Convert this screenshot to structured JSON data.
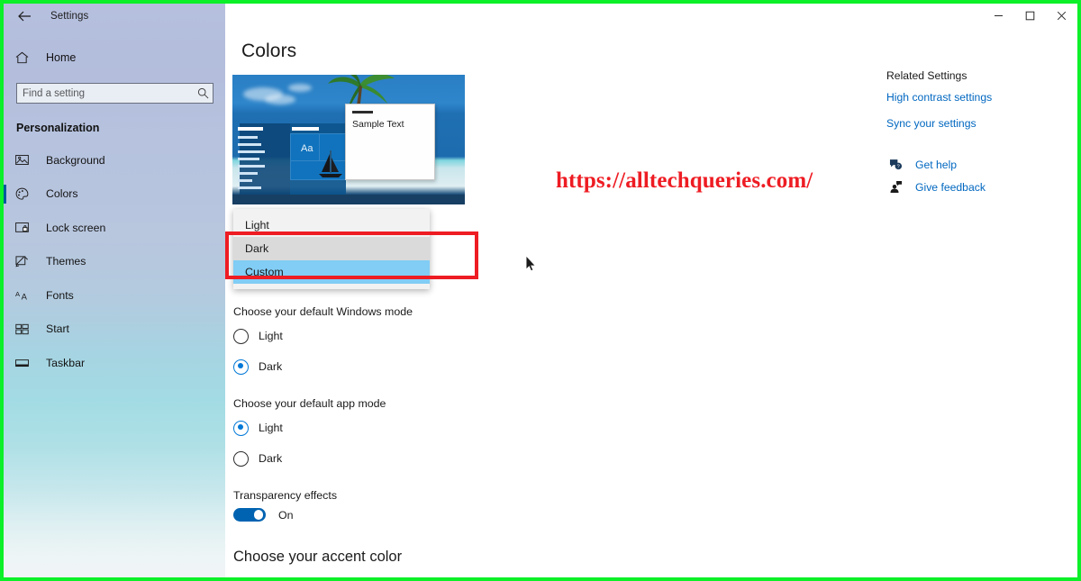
{
  "window": {
    "title": "Settings",
    "back_icon": "back-arrow-icon",
    "minimize_label": "–",
    "maximize_label": "❐",
    "close_label": "✕"
  },
  "sidebar": {
    "home_label": "Home",
    "home_icon": "home-icon",
    "search": {
      "placeholder": "Find a setting",
      "value": "",
      "icon": "search-icon"
    },
    "section_title": "Personalization",
    "items": [
      {
        "label": "Background",
        "icon": "picture-icon",
        "selected": false
      },
      {
        "label": "Colors",
        "icon": "palette-icon",
        "selected": true
      },
      {
        "label": "Lock screen",
        "icon": "lock-screen-icon",
        "selected": false
      },
      {
        "label": "Themes",
        "icon": "brush-icon",
        "selected": false
      },
      {
        "label": "Fonts",
        "icon": "fonts-icon",
        "selected": false
      },
      {
        "label": "Start",
        "icon": "start-tiles-icon",
        "selected": false
      },
      {
        "label": "Taskbar",
        "icon": "taskbar-icon",
        "selected": false
      }
    ]
  },
  "main": {
    "page_title": "Colors",
    "preview": {
      "sample_text": "Sample Text",
      "tile_text": "Aa"
    },
    "color_mode_dropdown": {
      "options": [
        "Light",
        "Dark",
        "Custom"
      ],
      "hovered": "Dark",
      "selected": "Custom"
    },
    "windows_mode": {
      "label": "Choose your default Windows mode",
      "options": [
        {
          "label": "Light",
          "checked": false
        },
        {
          "label": "Dark",
          "checked": true
        }
      ]
    },
    "app_mode": {
      "label": "Choose your default app mode",
      "options": [
        {
          "label": "Light",
          "checked": true
        },
        {
          "label": "Dark",
          "checked": false
        }
      ]
    },
    "transparency": {
      "label": "Transparency effects",
      "state_label": "On",
      "on": true
    },
    "accent_heading": "Choose your accent color"
  },
  "rail": {
    "title": "Related Settings",
    "links": [
      "High contrast settings",
      "Sync your settings"
    ],
    "actions": [
      {
        "label": "Get help",
        "icon": "help-chat-icon"
      },
      {
        "label": "Give feedback",
        "icon": "feedback-person-icon"
      }
    ]
  },
  "watermark": {
    "text": "https://alltechqueries.com/"
  },
  "colors": {
    "accent": "#0078d7",
    "highlight_red": "#ee1c23",
    "capture_border_green": "#0bf028",
    "link_blue": "#0067c0",
    "dropdown_selected_blue": "#81cdf5",
    "dropdown_hover_gray": "#dadada",
    "toggle_on_blue": "#0063b1"
  }
}
